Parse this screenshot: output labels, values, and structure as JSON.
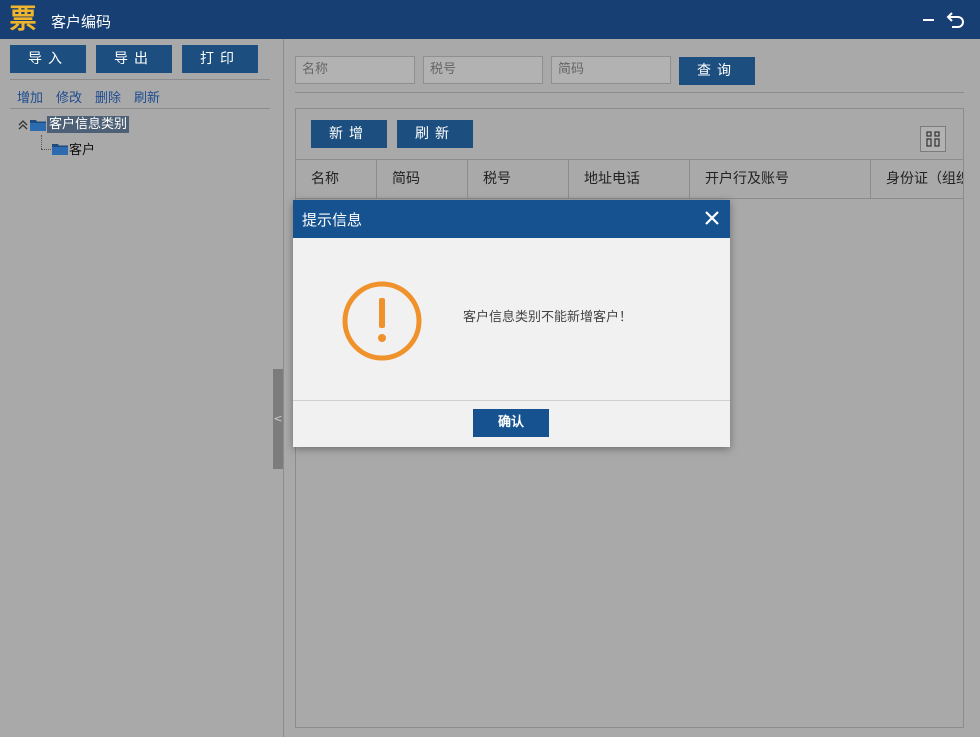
{
  "window": {
    "logo_text": "票",
    "title": "客户编码",
    "icons": [
      "minimize-icon",
      "back-icon"
    ]
  },
  "left_panel": {
    "buttons": {
      "import": "导入",
      "export": "导出",
      "print": "打印"
    },
    "links": {
      "add": "增加",
      "edit": "修改",
      "delete": "删除",
      "refresh": "刷新"
    },
    "tree": {
      "root_label": "客户信息类别",
      "child_label": "客户"
    },
    "splitter_glyph": "<"
  },
  "search": {
    "name_placeholder": "名称",
    "tax_placeholder": "税号",
    "code_placeholder": "简码",
    "query_label": "查询"
  },
  "grid": {
    "new_label": "新增",
    "refresh_label": "刷新",
    "columns": [
      "名称",
      "简码",
      "税号",
      "地址电话",
      "开户行及账号",
      "身份证（组织"
    ]
  },
  "dialog": {
    "title": "提示信息",
    "message": "客户信息类别不能新增客户！",
    "confirm_label": "确认",
    "icon": "warning-icon",
    "accent_color": "#f0922b",
    "header_color": "#16528f"
  }
}
